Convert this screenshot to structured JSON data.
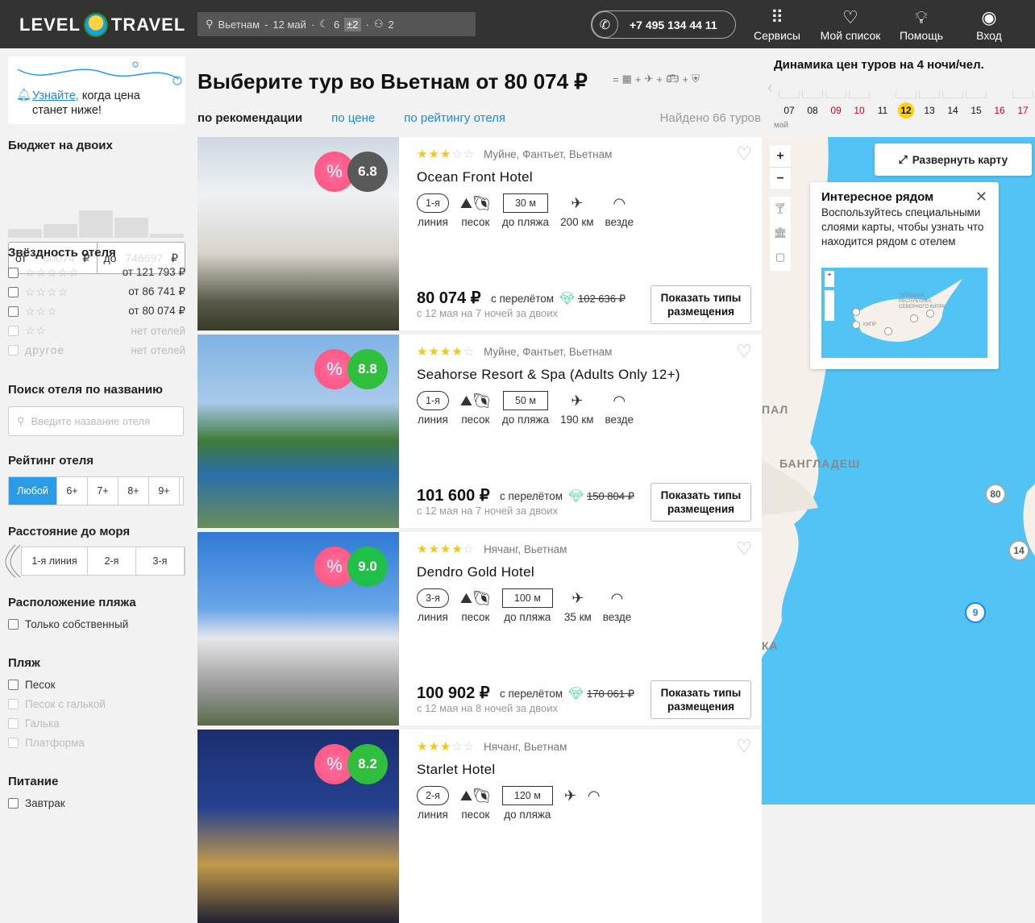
{
  "header": {
    "logo_left": "LEVEL",
    "logo_right": "TRAVEL",
    "search": {
      "destination": "Вьетнам",
      "date": "12 май",
      "nights": "6",
      "nights_pm": "±2",
      "adults": "2"
    },
    "phone": "+7 495 134 44 11",
    "nav": [
      {
        "label": "Сервисы",
        "icon": "grid-icon"
      },
      {
        "label": "Мой список",
        "icon": "heart-icon"
      },
      {
        "label": "Помощь",
        "icon": "bulb-icon"
      },
      {
        "label": "Вход",
        "icon": "user-icon"
      }
    ]
  },
  "sidebar": {
    "notify": {
      "link": "Узнайте,",
      "text1": " когда цена",
      "text2": "станет ниже!"
    },
    "budget": {
      "title": "Бюджет на двоих",
      "from_label": "от",
      "from_value": "80074",
      "to_label": "до",
      "to_value": "746697",
      "currency": "₽",
      "histogram": [
        0.3,
        0.45,
        0.9,
        0.65,
        0.12
      ]
    },
    "stars": {
      "title": "Звёздность отеля",
      "items": [
        {
          "stars": "☆☆☆☆☆",
          "price": "от 121 793 ₽",
          "disabled": false
        },
        {
          "stars": "☆☆☆☆",
          "price": "от 86 741 ₽",
          "disabled": false
        },
        {
          "stars": "☆☆☆",
          "price": "от 80 074 ₽",
          "disabled": false
        },
        {
          "stars": "☆☆",
          "price": "нет отелей",
          "disabled": true
        },
        {
          "stars": "другое",
          "price": "нет отелей",
          "disabled": true
        }
      ]
    },
    "hotel_search": {
      "title": "Поиск отеля по названию",
      "placeholder": "Введите название отеля"
    },
    "rating": {
      "title": "Рейтинг отеля",
      "options": [
        "Любой",
        "6+",
        "7+",
        "8+",
        "9+"
      ]
    },
    "distance": {
      "title": "Расстояние до моря",
      "options": [
        "1-я линия",
        "2-я",
        "3-я"
      ]
    },
    "beach_loc": {
      "title": "Расположение пляжа",
      "options": [
        "Только собственный"
      ]
    },
    "beach": {
      "title": "Пляж",
      "options": [
        {
          "label": "Песок",
          "disabled": false
        },
        {
          "label": "Песок с галькой",
          "disabled": true
        },
        {
          "label": "Галька",
          "disabled": true
        },
        {
          "label": "Платформа",
          "disabled": true
        }
      ]
    },
    "food": {
      "title": "Питание",
      "options": [
        "Завтрак"
      ]
    }
  },
  "main": {
    "title": "Выберите тур во Вьетнам от 80 074 ₽",
    "sorts": [
      "по рекомендации",
      "по цене",
      "по рейтингу отеля"
    ],
    "found": "Найдено 66 туров",
    "cards": [
      {
        "stars": 3,
        "location": "Муйне, Фантьет, Вьетнам",
        "name": "Ocean Front Hotel",
        "rating": "6.8",
        "rating_color": "#595959",
        "line": "1-я",
        "line_label": "линия",
        "beach": "песок",
        "beach_dist": "30 м",
        "beach_dist_label": "до пляжа",
        "airport": "200 км",
        "wifi": "везде",
        "price": "80 074 ₽",
        "with_flight": "с перелётом",
        "old_price": "102 636 ₽",
        "dates": "с 12 мая на 7 ночей за двоих",
        "button": "Показать типы размещения"
      },
      {
        "stars": 4,
        "location": "Муйне, Фантьет, Вьетнам",
        "name": "Seahorse Resort & Spa (Adults Only 12+)",
        "rating": "8.8",
        "rating_color": "#2fbf3c",
        "line": "1-я",
        "line_label": "линия",
        "beach": "песок",
        "beach_dist": "50 м",
        "beach_dist_label": "до пляжа",
        "airport": "190 км",
        "wifi": "везде",
        "price": "101 600 ₽",
        "with_flight": "с перелётом",
        "old_price": "150 804 ₽",
        "dates": "с 12 мая на 7 ночей за двоих",
        "button": "Показать типы размещения"
      },
      {
        "stars": 4,
        "location": "Нячанг, Вьетнам",
        "name": "Dendro Gold Hotel",
        "rating": "9.0",
        "rating_color": "#1fbf4a",
        "line": "3-я",
        "line_label": "линия",
        "beach": "песок",
        "beach_dist": "100 м",
        "beach_dist_label": "до пляжа",
        "airport": "35 км",
        "wifi": "везде",
        "price": "100 902 ₽",
        "with_flight": "с перелётом",
        "old_price": "170 061 ₽",
        "dates": "с 12 мая на 8 ночей за двоих",
        "button": "Показать типы размещения"
      },
      {
        "stars": 3,
        "location": "Нячанг, Вьетнам",
        "name": "Starlet Hotel",
        "rating": "8.2",
        "rating_color": "#2fbf3c",
        "line": "2-я",
        "line_label": "линия",
        "beach": "песок",
        "beach_dist": "120 м",
        "beach_dist_label": "до пляжа",
        "airport": "",
        "wifi": "",
        "price": "",
        "with_flight": "",
        "old_price": "",
        "dates": "",
        "button": ""
      }
    ]
  },
  "dynamics": {
    "title": "Динамика цен туров на 4 ночи/чел.",
    "days": [
      {
        "d": "07",
        "red": false
      },
      {
        "d": "08",
        "red": false
      },
      {
        "d": "09",
        "red": true
      },
      {
        "d": "10",
        "red": true
      },
      {
        "d": "11",
        "red": false
      },
      {
        "d": "12",
        "red": false,
        "selected": true
      },
      {
        "d": "13",
        "red": false
      },
      {
        "d": "14",
        "red": false
      },
      {
        "d": "15",
        "red": false
      },
      {
        "d": "16",
        "red": true
      },
      {
        "d": "17",
        "red": true
      }
    ],
    "month": "май"
  },
  "map": {
    "expand": "Развернуть карту",
    "popup_title": "Интересное рядом",
    "popup_text": "Воспользуйтесь специальными слоями карты, чтобы узнать что находится рядом с отелем",
    "mini_labels": [
      "ТУРЕЦКАЯ",
      "РЕСПУБЛИКА",
      "СЕВЕРНОГО КИПРА",
      "КИПР"
    ],
    "labels": [
      "ПАЛ",
      "БАНГЛАДЕШ",
      "КА"
    ],
    "pins": [
      "80",
      "14",
      "9"
    ]
  },
  "colors": {
    "accent": "#1e88e5",
    "topbar": "#333333",
    "sea": "#52c3f5",
    "star": "#f5c518"
  }
}
